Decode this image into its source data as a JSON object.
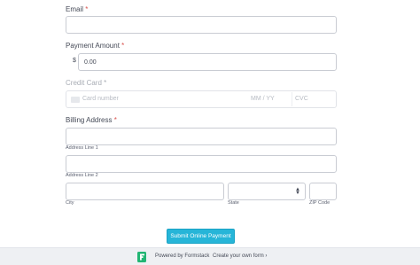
{
  "form": {
    "email": {
      "label": "Email",
      "required_mark": "*",
      "value": ""
    },
    "payment_amount": {
      "label": "Payment Amount",
      "required_mark": "*",
      "currency_symbol": "$",
      "value": "0.00"
    },
    "credit_card": {
      "label": "Credit Card",
      "required_mark": "*",
      "card_number_placeholder": "Card number",
      "expiry_placeholder": "MM / YY",
      "cvc_placeholder": "CVC"
    },
    "billing_address": {
      "label": "Billing Address",
      "required_mark": "*",
      "line1_label": "Address Line 1",
      "line2_label": "Address Line 2",
      "city_label": "City",
      "state_label": "State",
      "zip_label": "ZIP Code",
      "line1_value": "",
      "line2_value": "",
      "city_value": "",
      "state_value": "",
      "zip_value": ""
    },
    "submit_label": "Submit Online Payment"
  },
  "footer": {
    "powered_by": "Powered by Formstack",
    "create_form": "Create your own form",
    "chevron": "›"
  },
  "colors": {
    "accent": "#26b5d8",
    "required": "#d9534f",
    "brand_green": "#21b573"
  }
}
